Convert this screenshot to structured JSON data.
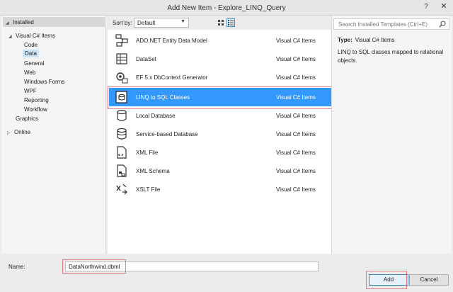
{
  "window": {
    "title": "Add New Item - Explore_LINQ_Query",
    "help_glyph": "?",
    "close_glyph": "✕"
  },
  "tree": {
    "installed": "Installed",
    "visual_cs": "Visual C# Items",
    "children": [
      "Code",
      "Data",
      "General",
      "Web",
      "Windows Forms",
      "WPF",
      "Reporting",
      "Workflow"
    ],
    "graphics": "Graphics",
    "online": "Online",
    "selected": "Data"
  },
  "toolbar": {
    "sort_label": "Sort by:",
    "sort_value": "Default"
  },
  "templates": [
    {
      "name": "ADO.NET Entity Data Model",
      "type": "Visual C# Items",
      "icon": "entity-model-icon"
    },
    {
      "name": "DataSet",
      "type": "Visual C# Items",
      "icon": "dataset-icon"
    },
    {
      "name": "EF 5.x DbContext Generator",
      "type": "Visual C# Items",
      "icon": "ef-generator-icon"
    },
    {
      "name": "LINQ to SQL Classes",
      "type": "Visual C# Items",
      "icon": "linq-classes-icon"
    },
    {
      "name": "Local Database",
      "type": "Visual C# Items",
      "icon": "local-database-icon"
    },
    {
      "name": "Service-based Database",
      "type": "Visual C# Items",
      "icon": "service-database-icon"
    },
    {
      "name": "XML File",
      "type": "Visual C# Items",
      "icon": "xml-file-icon"
    },
    {
      "name": "XML Schema",
      "type": "Visual C# Items",
      "icon": "xml-schema-icon"
    },
    {
      "name": "XSLT File",
      "type": "Visual C# Items",
      "icon": "xslt-file-icon"
    }
  ],
  "selected_template": "LINQ to SQL Classes",
  "details": {
    "search_placeholder": "Search Installed Templates (Ctrl+E)",
    "type_label": "Type:",
    "type_value": "Visual C# Items",
    "description": "LINQ to SQL classes mapped to relational objects."
  },
  "footer": {
    "name_label": "Name:",
    "name_value": "DataNorthwind.dbml",
    "add_label": "Add",
    "cancel_label": "Cancel"
  },
  "colors": {
    "selection": "#3399ff",
    "highlight_box": "#e07a84"
  }
}
